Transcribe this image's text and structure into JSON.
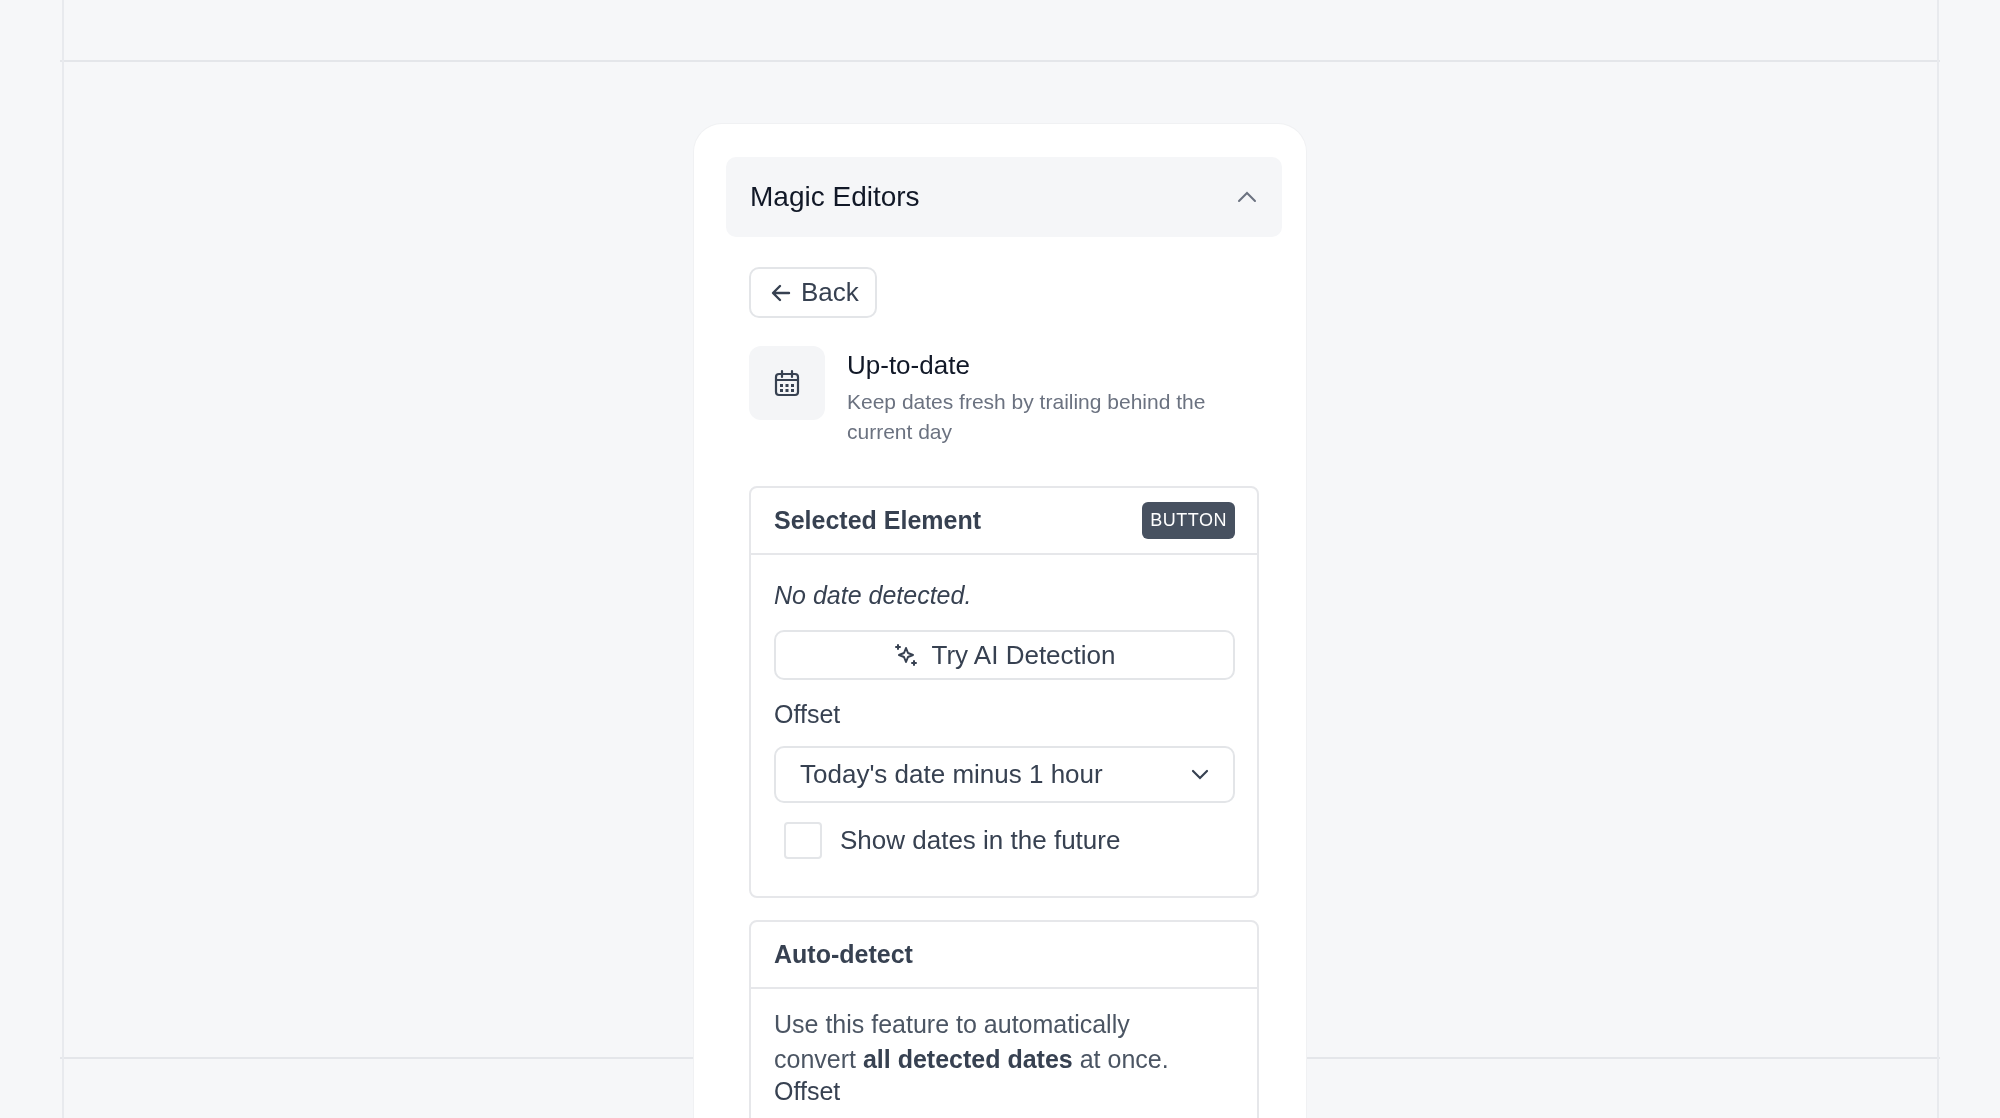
{
  "panel": {
    "title": "Magic Editors",
    "expanded": true
  },
  "back_button": {
    "label": "Back"
  },
  "tool": {
    "title": "Up-to-date",
    "description": "Keep dates fresh by trailing behind the current day"
  },
  "selected_element": {
    "title": "Selected Element",
    "badge": "BUTTON",
    "status": "No date detected.",
    "ai_button": "Try AI Detection",
    "offset_label": "Offset",
    "offset_value": "Today's date minus 1 hour",
    "checkbox": {
      "label": "Show dates in the future",
      "checked": false
    }
  },
  "auto_detect": {
    "title": "Auto-detect",
    "description": "Use this feature to automatically convert **all detected dates** at once.",
    "offset_label": "Offset"
  }
}
